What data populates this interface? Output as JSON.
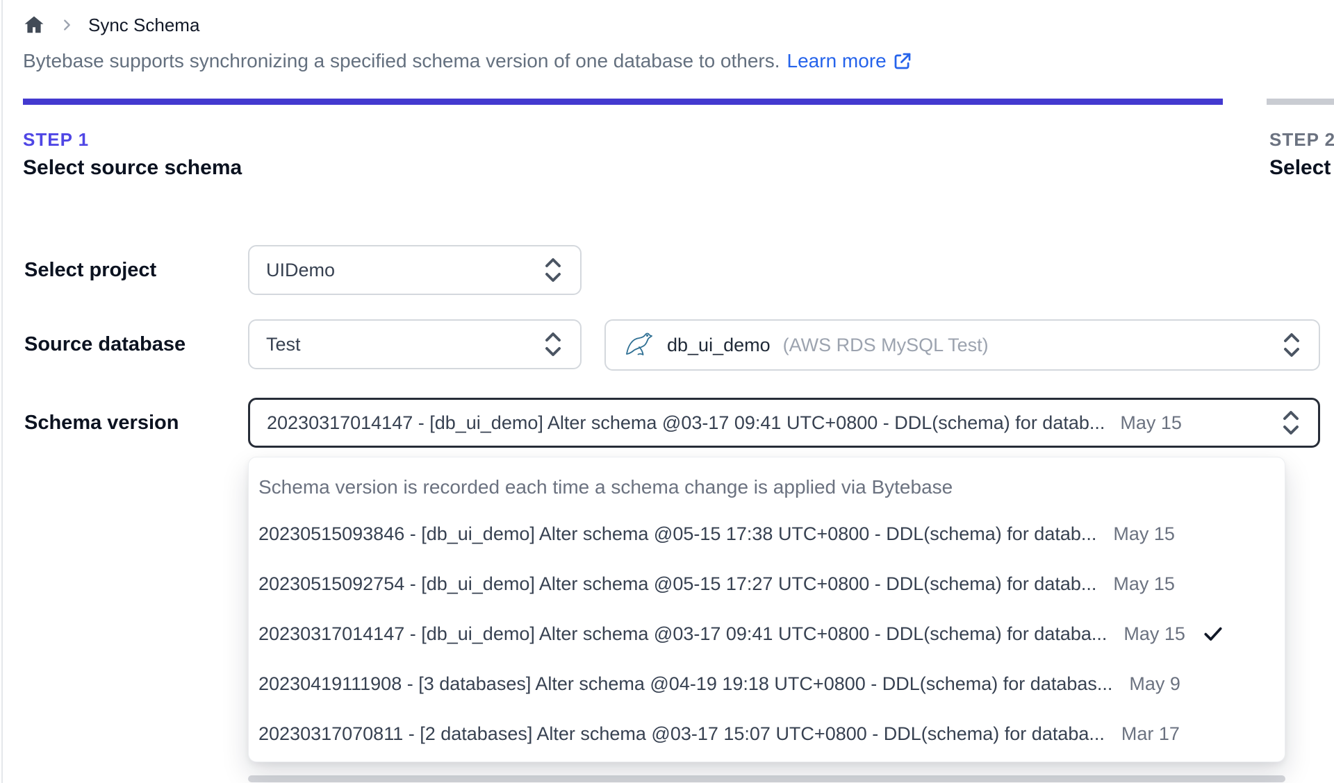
{
  "breadcrumb": {
    "page_title": "Sync Schema"
  },
  "header": {
    "description": "Bytebase supports synchronizing a specified schema version of one database to others.",
    "learn_more_label": "Learn more"
  },
  "steps": [
    {
      "label": "STEP 1",
      "title": "Select source schema",
      "active": true
    },
    {
      "label": "STEP 2",
      "title": "Select t",
      "active": false
    }
  ],
  "form": {
    "project": {
      "label": "Select project",
      "value": "UIDemo"
    },
    "source_database": {
      "label": "Source database",
      "environment_value": "Test",
      "database_name": "db_ui_demo",
      "database_instance": "(AWS RDS MySQL Test)",
      "engine_icon": "mysql-icon"
    },
    "schema_version": {
      "label": "Schema version",
      "value": "20230317014147 - [db_ui_demo] Alter schema @03-17 09:41 UTC+0800 - DDL(schema) for datab...",
      "value_date": "May 15"
    }
  },
  "dropdown": {
    "hint": "Schema version is recorded each time a schema change is applied via Bytebase",
    "options": [
      {
        "text": "20230515093846 - [db_ui_demo] Alter schema @05-15 17:38 UTC+0800 - DDL(schema) for datab...",
        "date": "May 15",
        "selected": false
      },
      {
        "text": "20230515092754 - [db_ui_demo] Alter schema @05-15 17:27 UTC+0800 - DDL(schema) for datab...",
        "date": "May 15",
        "selected": false
      },
      {
        "text": "20230317014147 - [db_ui_demo] Alter schema @03-17 09:41 UTC+0800 - DDL(schema) for databa...",
        "date": "May 15",
        "selected": true
      },
      {
        "text": "20230419111908 - [3 databases] Alter schema @04-19 19:18 UTC+0800 - DDL(schema) for databas...",
        "date": "May 9",
        "selected": false
      },
      {
        "text": "20230317070811 - [2 databases] Alter schema @03-17 15:07 UTC+0800 - DDL(schema) for databa...",
        "date": "Mar 17",
        "selected": false
      }
    ]
  },
  "colors": {
    "accent_indigo": "#4f46e5",
    "progress_active": "#4339cf",
    "progress_inactive": "#c9ccd2",
    "link_blue": "#2563eb",
    "text_muted": "#6b7280",
    "focus_border": "#272d38"
  }
}
